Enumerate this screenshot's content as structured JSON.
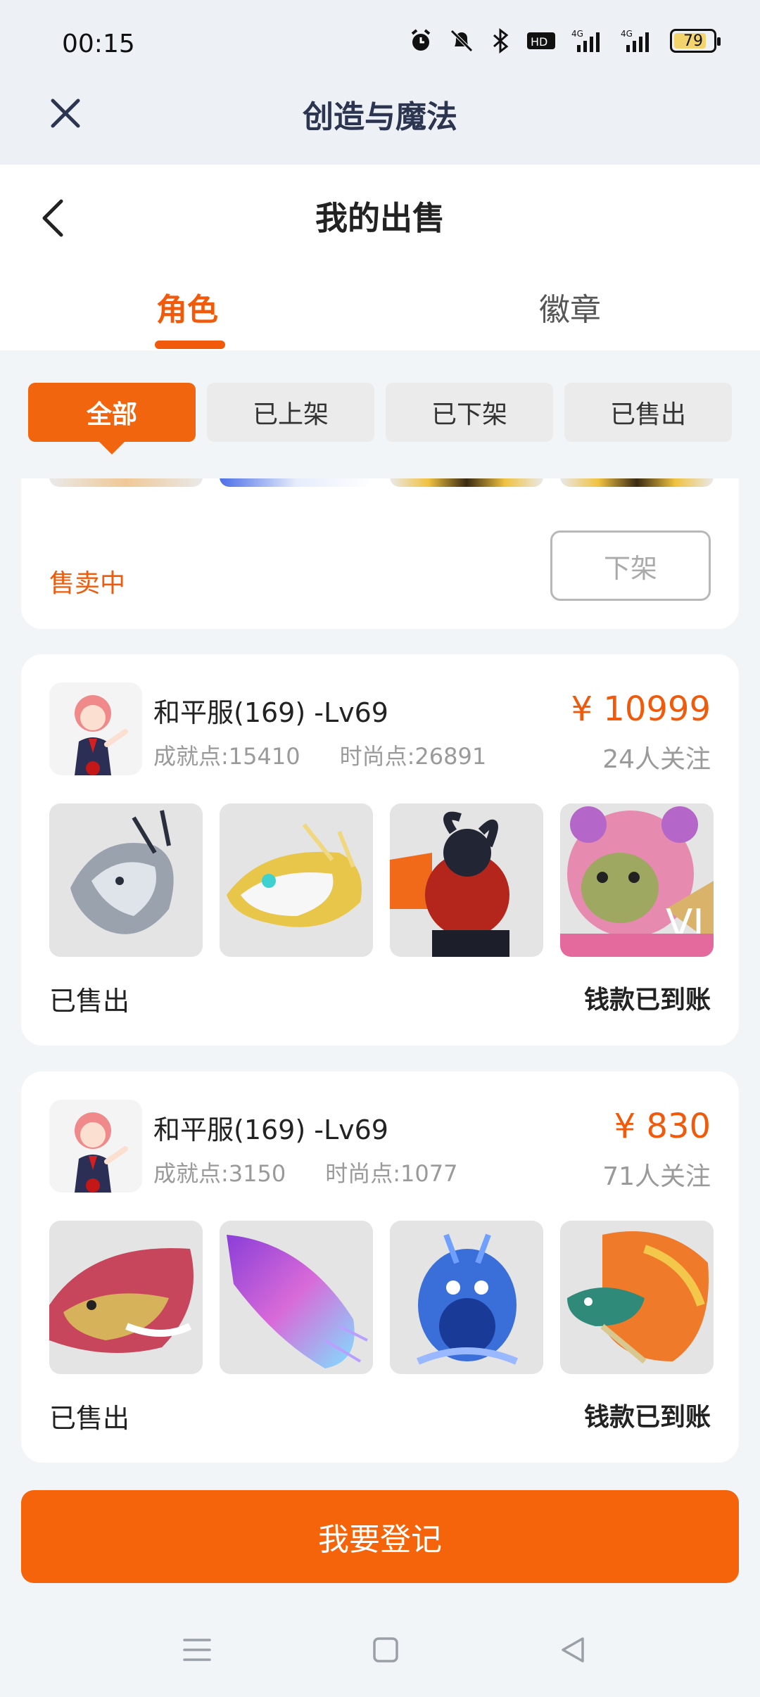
{
  "status_bar": {
    "time": "00:15",
    "battery": "79",
    "icons": [
      "alarm-icon",
      "mute-bell-icon",
      "bluetooth-icon",
      "hd-icon",
      "signal-4g-icon",
      "signal-4g-icon",
      "battery-icon"
    ]
  },
  "app": {
    "title": "创造与魔法"
  },
  "page": {
    "title": "我的出售"
  },
  "tabs": [
    {
      "label": "角色",
      "active": true
    },
    {
      "label": "徽章",
      "active": false
    }
  ],
  "filters": [
    {
      "label": "全部",
      "active": true
    },
    {
      "label": "已上架",
      "active": false
    },
    {
      "label": "已下架",
      "active": false
    },
    {
      "label": "已售出",
      "active": false
    }
  ],
  "partial_card": {
    "status": "售卖中",
    "action": "下架"
  },
  "cards": [
    {
      "name": "和平服(169) -Lv69",
      "achievement": "成就点:15410",
      "fashion": "时尚点:26891",
      "price": "¥ 10999",
      "followers": "24人关注",
      "status": "已售出",
      "payment": "钱款已到账",
      "thumb_colors": [
        "#9aa2ae",
        "#e8c64a",
        "#b4261c",
        "#e78ab0"
      ]
    },
    {
      "name": "和平服(169) -Lv69",
      "achievement": "成就点:3150",
      "fashion": "时尚点:1077",
      "price": "¥ 830",
      "followers": "71人关注",
      "status": "已售出",
      "payment": "钱款已到账",
      "thumb_colors": [
        "#c8465c",
        "#b56ad8",
        "#3a6ed8",
        "#ee7a2a"
      ]
    }
  ],
  "register_button": "我要登记",
  "colors": {
    "accent": "#f05a0a",
    "button": "#f5640a"
  }
}
